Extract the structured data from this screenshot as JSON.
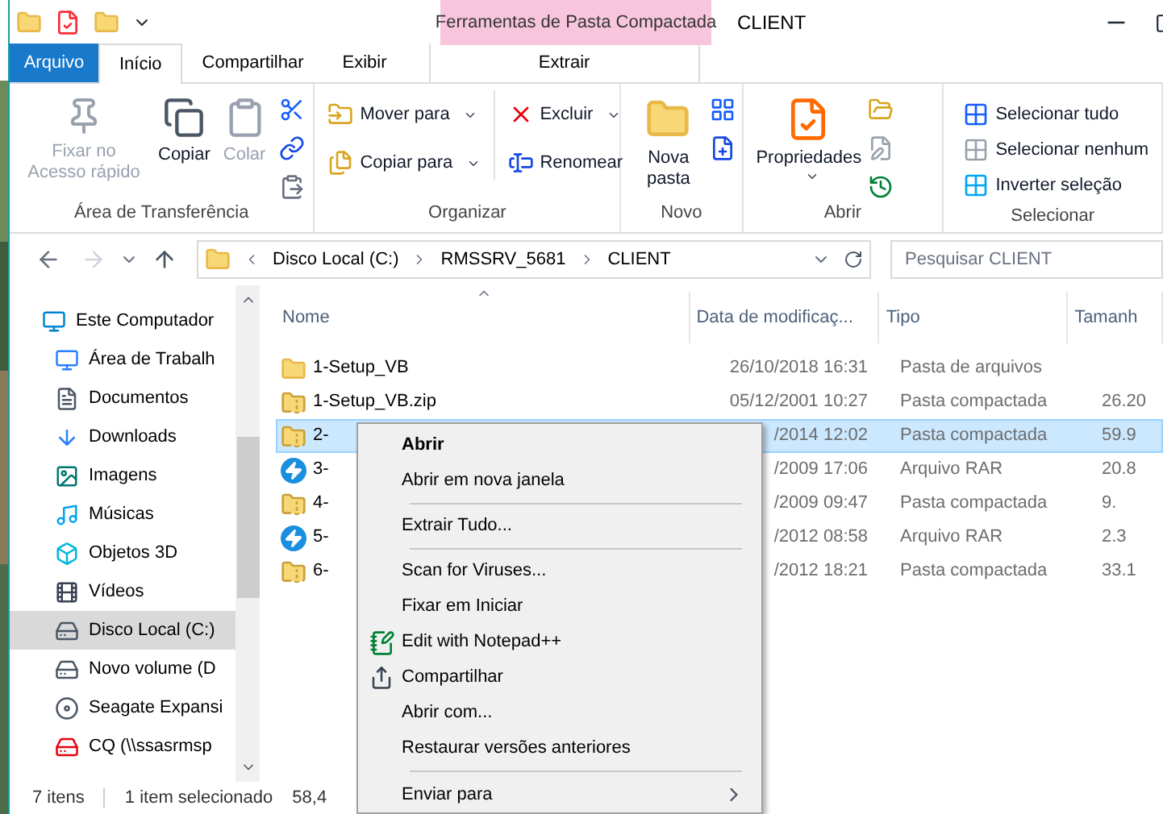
{
  "title_bar": {
    "context_group": "Ferramentas de Pasta Compactada",
    "title": "CLIENT"
  },
  "tabs": [
    {
      "label": "Arquivo",
      "kind": "file",
      "selected": false
    },
    {
      "label": "Início",
      "kind": "normal",
      "selected": true
    },
    {
      "label": "Compartilhar",
      "kind": "normal",
      "selected": false
    },
    {
      "label": "Exibir",
      "kind": "normal",
      "selected": false
    },
    {
      "label": "Extrair",
      "kind": "context",
      "selected": false
    }
  ],
  "ribbon": [
    {
      "label": "Área de Transferência",
      "items": [
        {
          "label": "Fixar no Acesso rápido",
          "kind": "large",
          "disabled": true
        },
        {
          "label": "Copiar",
          "kind": "large",
          "disabled": false
        },
        {
          "label": "Colar",
          "kind": "large",
          "disabled": true
        }
      ]
    },
    {
      "label": "Organizar",
      "items": [
        {
          "label": "Mover para",
          "kind": "small",
          "dropdown": true
        },
        {
          "label": "Copiar para",
          "kind": "small",
          "dropdown": true
        },
        {
          "label": "Excluir",
          "kind": "small",
          "dropdown": true
        },
        {
          "label": "Renomear",
          "kind": "small",
          "dropdown": false
        }
      ]
    },
    {
      "label": "Novo",
      "items": [
        {
          "label": "Nova pasta",
          "kind": "large"
        }
      ]
    },
    {
      "label": "Abrir",
      "items": [
        {
          "label": "Propriedades",
          "kind": "large",
          "dropdown": true
        }
      ]
    },
    {
      "label": "Selecionar",
      "items": [
        {
          "label": "Selecionar tudo",
          "kind": "small"
        },
        {
          "label": "Selecionar nenhum",
          "kind": "small"
        },
        {
          "label": "Inverter seleção",
          "kind": "small"
        }
      ]
    }
  ],
  "address": {
    "crumbs": [
      "Disco Local (C:)",
      "RMSSRV_5681",
      "CLIENT"
    ],
    "search_placeholder": "Pesquisar CLIENT"
  },
  "nav": [
    {
      "label": "Este Computador",
      "kind": "computer",
      "selected": false
    },
    {
      "label": "Área de Trabalh",
      "kind": "desktop",
      "selected": false
    },
    {
      "label": "Documentos",
      "kind": "documents",
      "selected": false
    },
    {
      "label": "Downloads",
      "kind": "downloads",
      "selected": false
    },
    {
      "label": "Imagens",
      "kind": "pictures",
      "selected": false
    },
    {
      "label": "Músicas",
      "kind": "music",
      "selected": false
    },
    {
      "label": "Objetos 3D",
      "kind": "objects",
      "selected": false
    },
    {
      "label": "Vídeos",
      "kind": "videos",
      "selected": false
    },
    {
      "label": "Disco Local (C:)",
      "kind": "drive",
      "selected": true
    },
    {
      "label": "Novo volume (D",
      "kind": "drive",
      "selected": false
    },
    {
      "label": "Seagate Expansi",
      "kind": "external",
      "selected": false
    },
    {
      "label": "CQ (\\\\ssasrmsp",
      "kind": "network",
      "selected": false
    }
  ],
  "columns": [
    "Nome",
    "Data de modificaç...",
    "Tipo",
    "Tamanh"
  ],
  "rows": [
    {
      "name": "1-Setup_VB",
      "date": "26/10/2018 16:31",
      "type": "Pasta de arquivos",
      "size": "",
      "kind": "folder",
      "selected": false
    },
    {
      "name": "1-Setup_VB.zip",
      "date": "05/12/2001 10:27",
      "type": "Pasta compactada",
      "size": "26.20",
      "kind": "zip",
      "selected": false
    },
    {
      "name": "2-",
      "date": "/2014 12:02",
      "type": "Pasta compactada",
      "size": "59.9",
      "kind": "zip",
      "selected": true
    },
    {
      "name": "3-",
      "date": "/2009 17:06",
      "type": "Arquivo RAR",
      "size": "20.8",
      "kind": "rar",
      "selected": false
    },
    {
      "name": "4-",
      "date": "/2009 09:47",
      "type": "Pasta compactada",
      "size": "9.",
      "kind": "zip",
      "selected": false
    },
    {
      "name": "5-",
      "date": "/2012 08:58",
      "type": "Arquivo RAR",
      "size": "2.3",
      "kind": "rar",
      "selected": false
    },
    {
      "name": "6-",
      "date": "/2012 18:21",
      "type": "Pasta compactada",
      "size": "33.1",
      "kind": "zip",
      "selected": false
    }
  ],
  "status": [
    "7 itens",
    "1 item selecionado",
    "58,4"
  ],
  "context_menu": [
    {
      "kind": "item",
      "label": "Abrir",
      "default": true
    },
    {
      "kind": "item",
      "label": "Abrir em nova janela"
    },
    {
      "kind": "separator"
    },
    {
      "kind": "item",
      "label": "Extrair Tudo..."
    },
    {
      "kind": "separator"
    },
    {
      "kind": "item",
      "label": "Scan for Viruses..."
    },
    {
      "kind": "item",
      "label": "Fixar em Iniciar"
    },
    {
      "kind": "notepad",
      "label": "Edit with Notepad++"
    },
    {
      "kind": "share",
      "label": "Compartilhar"
    },
    {
      "kind": "item",
      "label": "Abrir com..."
    },
    {
      "kind": "item",
      "label": "Restaurar versões anteriores"
    },
    {
      "kind": "separator"
    },
    {
      "kind": "submenu",
      "label": "Enviar para"
    }
  ]
}
